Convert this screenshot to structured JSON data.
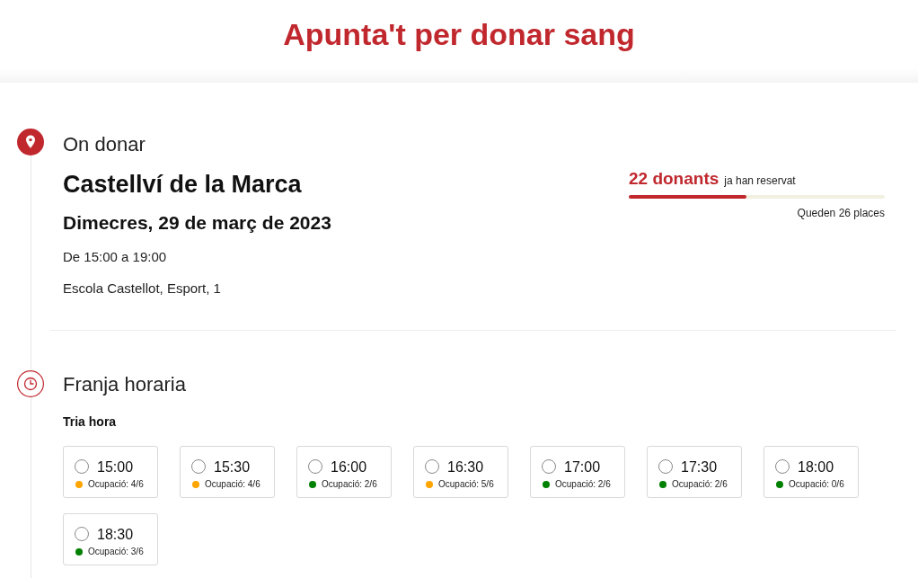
{
  "header": {
    "title": "Apunta't per donar sang"
  },
  "location": {
    "heading": "On donar",
    "place": "Castellví de la Marca",
    "date": "Dimecres, 29 de març de 2023",
    "hours": "De 15:00 a 19:00",
    "address": "Escola Castellot, Esport, 1"
  },
  "reservations": {
    "count": "22 donants",
    "caption": "ja han reservat",
    "level": 0.46,
    "remaining": "Queden 26 places"
  },
  "time_slot": {
    "heading": "Franja horaria",
    "prompt": "Tria hora",
    "slots": [
      {
        "time": "15:00",
        "occupancy": "Ocupació: 4/6",
        "color": "#ffa500",
        "selected": false
      },
      {
        "time": "15:30",
        "occupancy": "Ocupació: 4/6",
        "color": "#ffa500",
        "selected": false
      },
      {
        "time": "16:00",
        "occupancy": "Ocupació: 2/6",
        "color": "#008000",
        "selected": false
      },
      {
        "time": "16:30",
        "occupancy": "Ocupació: 5/6",
        "color": "#ffa500",
        "selected": false
      },
      {
        "time": "17:00",
        "occupancy": "Ocupació: 2/6",
        "color": "#008000",
        "selected": false
      },
      {
        "time": "17:30",
        "occupancy": "Ocupació: 2/6",
        "color": "#008000",
        "selected": false
      },
      {
        "time": "18:00",
        "occupancy": "Ocupació: 0/6",
        "color": "#008000",
        "selected": false
      },
      {
        "time": "18:30",
        "occupancy": "Ocupació: 3/6",
        "color": "#008000",
        "selected": false
      }
    ]
  }
}
